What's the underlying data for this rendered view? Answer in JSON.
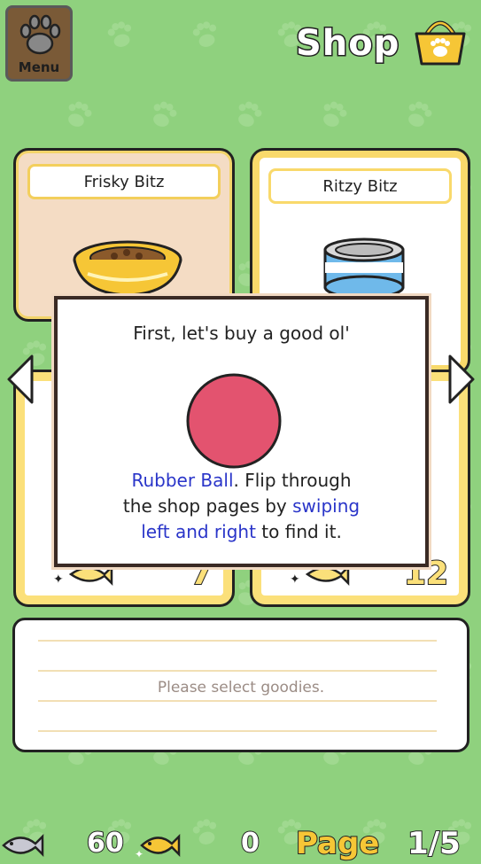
{
  "header": {
    "menu_label": "Menu",
    "title": "Shop"
  },
  "cards": [
    {
      "name": "Frisky Bitz",
      "price": "7",
      "image": "food-bowl-icon"
    },
    {
      "name": "Ritzy Bitz",
      "price": "12",
      "image": "tuna-can-icon"
    }
  ],
  "popup": {
    "line1": "First, let's buy a good ol'",
    "item_name": "Rubber Ball",
    "after_item": ". Flip through",
    "line3_prefix": "the shop pages by ",
    "swiping": "swiping",
    "left_right": "left and right",
    "line4_suffix": " to find it."
  },
  "description": {
    "placeholder": "Please select goodies."
  },
  "status": {
    "silver_fish": "60",
    "gold_fish": "0",
    "page_label": "Page",
    "page_number": "1/5"
  },
  "colors": {
    "background": "#8fd17e",
    "highlight": "#2a35c9",
    "ball": "#e3536f"
  }
}
